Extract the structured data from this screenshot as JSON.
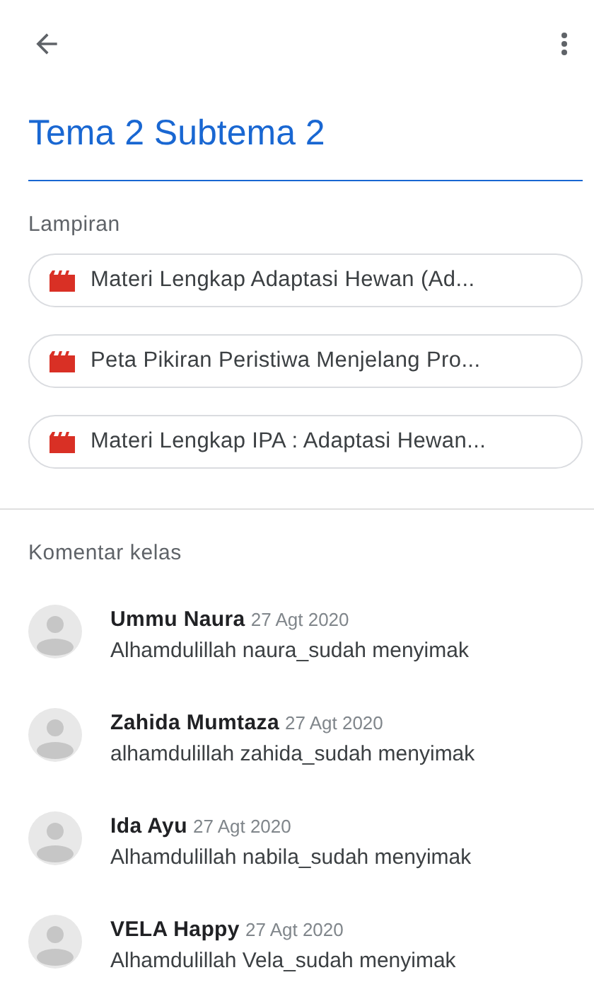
{
  "title": "Tema 2 Subtema 2",
  "attachments_label": "Lampiran",
  "attachments": [
    {
      "kind": "video",
      "title": "Materi Lengkap Adaptasi Hewan (Ad..."
    },
    {
      "kind": "video",
      "title": "Peta Pikiran Peristiwa Menjelang Pro..."
    },
    {
      "kind": "video",
      "title": "Materi Lengkap IPA : Adaptasi Hewan..."
    }
  ],
  "comments_label": "Komentar kelas",
  "comments": [
    {
      "name": "Ummu Naura",
      "date": "27 Agt 2020",
      "text": "Alhamdulillah naura_sudah menyimak"
    },
    {
      "name": "Zahida Mumtaza",
      "date": "27 Agt 2020",
      "text": "alhamdulillah zahida_sudah menyimak"
    },
    {
      "name": "Ida Ayu",
      "date": "27 Agt 2020",
      "text": "Alhamdulillah nabila_sudah menyimak"
    },
    {
      "name": "VELA Happy",
      "date": "27 Agt 2020",
      "text": "Alhamdulillah Vela_sudah menyimak"
    }
  ]
}
